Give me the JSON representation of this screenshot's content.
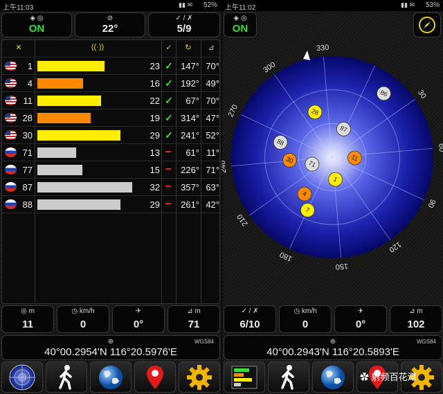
{
  "left": {
    "status": {
      "time": "上午11:03",
      "battery": "52%"
    },
    "tiles": [
      {
        "header": "◈ ◎",
        "value": "ON"
      },
      {
        "header": "⊘",
        "value": "22°"
      },
      {
        "header": "✓ / ✗",
        "value": "5/9"
      }
    ],
    "table": {
      "rows": [
        {
          "flag": "us",
          "id": "1",
          "bar_color": "#ffee00",
          "bar_fraction": 0.55,
          "snr": "23",
          "used": true,
          "azimuth": "147°",
          "elevation": "70°"
        },
        {
          "flag": "us",
          "id": "4",
          "bar_color": "#ff8a00",
          "bar_fraction": 0.38,
          "snr": "16",
          "used": true,
          "azimuth": "192°",
          "elevation": "49°"
        },
        {
          "flag": "us",
          "id": "11",
          "bar_color": "#ffee00",
          "bar_fraction": 0.52,
          "snr": "22",
          "used": true,
          "azimuth": "67°",
          "elevation": "70°"
        },
        {
          "flag": "us",
          "id": "28",
          "bar_color": "#ff8a00",
          "bar_fraction": 0.44,
          "snr": "19",
          "used": true,
          "azimuth": "314°",
          "elevation": "47°"
        },
        {
          "flag": "us",
          "id": "30",
          "bar_color": "#ffee00",
          "bar_fraction": 0.68,
          "snr": "29",
          "used": true,
          "azimuth": "241°",
          "elevation": "52°"
        },
        {
          "flag": "ru",
          "id": "71",
          "bar_color": "#cccccc",
          "bar_fraction": 0.32,
          "snr": "13",
          "used": false,
          "azimuth": "61°",
          "elevation": "11°"
        },
        {
          "flag": "ru",
          "id": "77",
          "bar_color": "#cccccc",
          "bar_fraction": 0.37,
          "snr": "15",
          "used": false,
          "azimuth": "226°",
          "elevation": "71°"
        },
        {
          "flag": "ru",
          "id": "87",
          "bar_color": "#cccccc",
          "bar_fraction": 0.77,
          "snr": "32",
          "used": false,
          "azimuth": "357°",
          "elevation": "63°"
        },
        {
          "flag": "ru",
          "id": "88",
          "bar_color": "#cccccc",
          "bar_fraction": 0.68,
          "snr": "29",
          "used": false,
          "azimuth": "261°",
          "elevation": "42°"
        }
      ]
    },
    "metrics": [
      {
        "unit": "m",
        "value": "11"
      },
      {
        "unit": "km/h",
        "value": "0"
      },
      {
        "unit": "",
        "value": "0°"
      },
      {
        "unit": "m",
        "value": "71"
      }
    ],
    "coords": {
      "datum": "WGS84",
      "text": "40°00.2954'N   116°20.5976'E"
    }
  },
  "right": {
    "status": {
      "time": "上午11:02",
      "battery": "53%"
    },
    "tiles": [
      {
        "header": "◈ ◎",
        "value": "ON"
      }
    ],
    "radar": {
      "azimuth_labels": [
        "30",
        "60",
        "90",
        "120",
        "150",
        "180",
        "210",
        "240",
        "270",
        "300",
        "330"
      ],
      "satellites": [
        {
          "id": "86",
          "azimuth": 14,
          "elevation": 17,
          "color": "#dddddd"
        },
        {
          "id": "87",
          "azimuth": 357,
          "elevation": 63,
          "color": "#dddddd"
        },
        {
          "id": "28",
          "azimuth": 314,
          "elevation": 47,
          "color": "#ffee00"
        },
        {
          "id": "11",
          "azimuth": 67,
          "elevation": 70,
          "color": "#ff8a00"
        },
        {
          "id": "71",
          "azimuth": 226,
          "elevation": 71,
          "color": "#dddddd"
        },
        {
          "id": "1",
          "azimuth": 147,
          "elevation": 70,
          "color": "#ffee00"
        },
        {
          "id": "88",
          "azimuth": 261,
          "elevation": 42,
          "color": "#dddddd"
        },
        {
          "id": "30",
          "azimuth": 241,
          "elevation": 52,
          "color": "#ff8a00"
        },
        {
          "id": "4",
          "azimuth": 192,
          "elevation": 49,
          "color": "#ff8a00"
        },
        {
          "id": "7",
          "azimuth": 180,
          "elevation": 38,
          "color": "#ffee00"
        }
      ]
    },
    "metrics": [
      {
        "unit": "✓ / ✗",
        "value": "6/10"
      },
      {
        "unit": "km/h",
        "value": "0"
      },
      {
        "unit": "",
        "value": "0°"
      },
      {
        "unit": "m",
        "value": "102"
      }
    ],
    "coords": {
      "datum": "WGS84",
      "text": "40°00.2943'N   116°20.5893'E"
    }
  },
  "watermark": "射频百花潭",
  "toolbar": [
    "radar-icon",
    "walk-icon",
    "globe-icon",
    "map-pin-icon",
    "settings-gear-icon"
  ]
}
